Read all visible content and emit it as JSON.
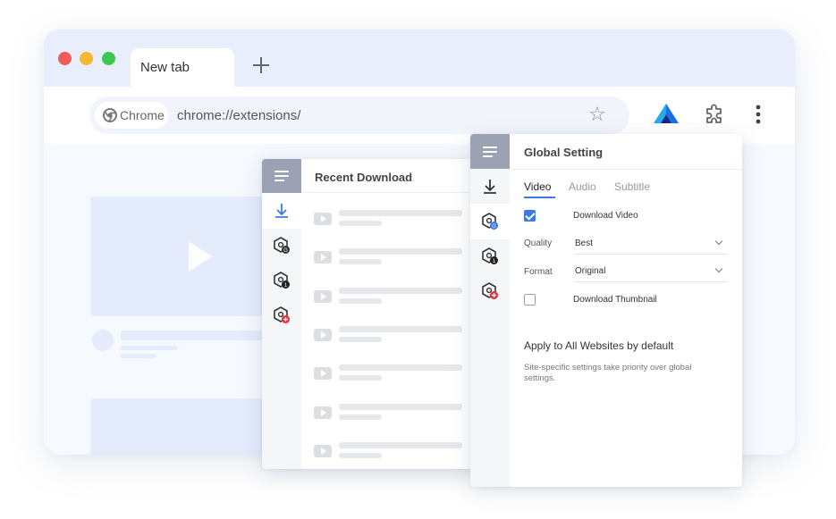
{
  "browser": {
    "tab_title": "New tab",
    "omnibox_chip": "Chrome",
    "url": "chrome://extensions/",
    "icons": {
      "bookmark": "star-icon",
      "extension_logo": "extension-logo-icon",
      "extensions": "puzzle-icon",
      "menu": "more-vert-icon",
      "new_tab": "plus-icon"
    },
    "colors": {
      "close": "#f05a5a",
      "minimize": "#f5b82e",
      "maximize": "#3cc850",
      "accent": "#3c78e6"
    }
  },
  "recent_panel": {
    "title": "Recent Download",
    "rows": 7
  },
  "settings_panel": {
    "title": "Global Setting",
    "tabs": [
      {
        "label": "Video",
        "active": true
      },
      {
        "label": "Audio",
        "active": false
      },
      {
        "label": "Subtitle",
        "active": false
      }
    ],
    "download_video": {
      "label": "Download Video",
      "checked": true
    },
    "quality": {
      "label": "Quality",
      "value": "Best"
    },
    "format": {
      "label": "Format",
      "value": "Original"
    },
    "download_thumbnail": {
      "label": "Download Thumbnail",
      "checked": false
    },
    "apply_label": "Apply to All Websites  by default",
    "note": "Site-specific settings take priority over global settings."
  }
}
